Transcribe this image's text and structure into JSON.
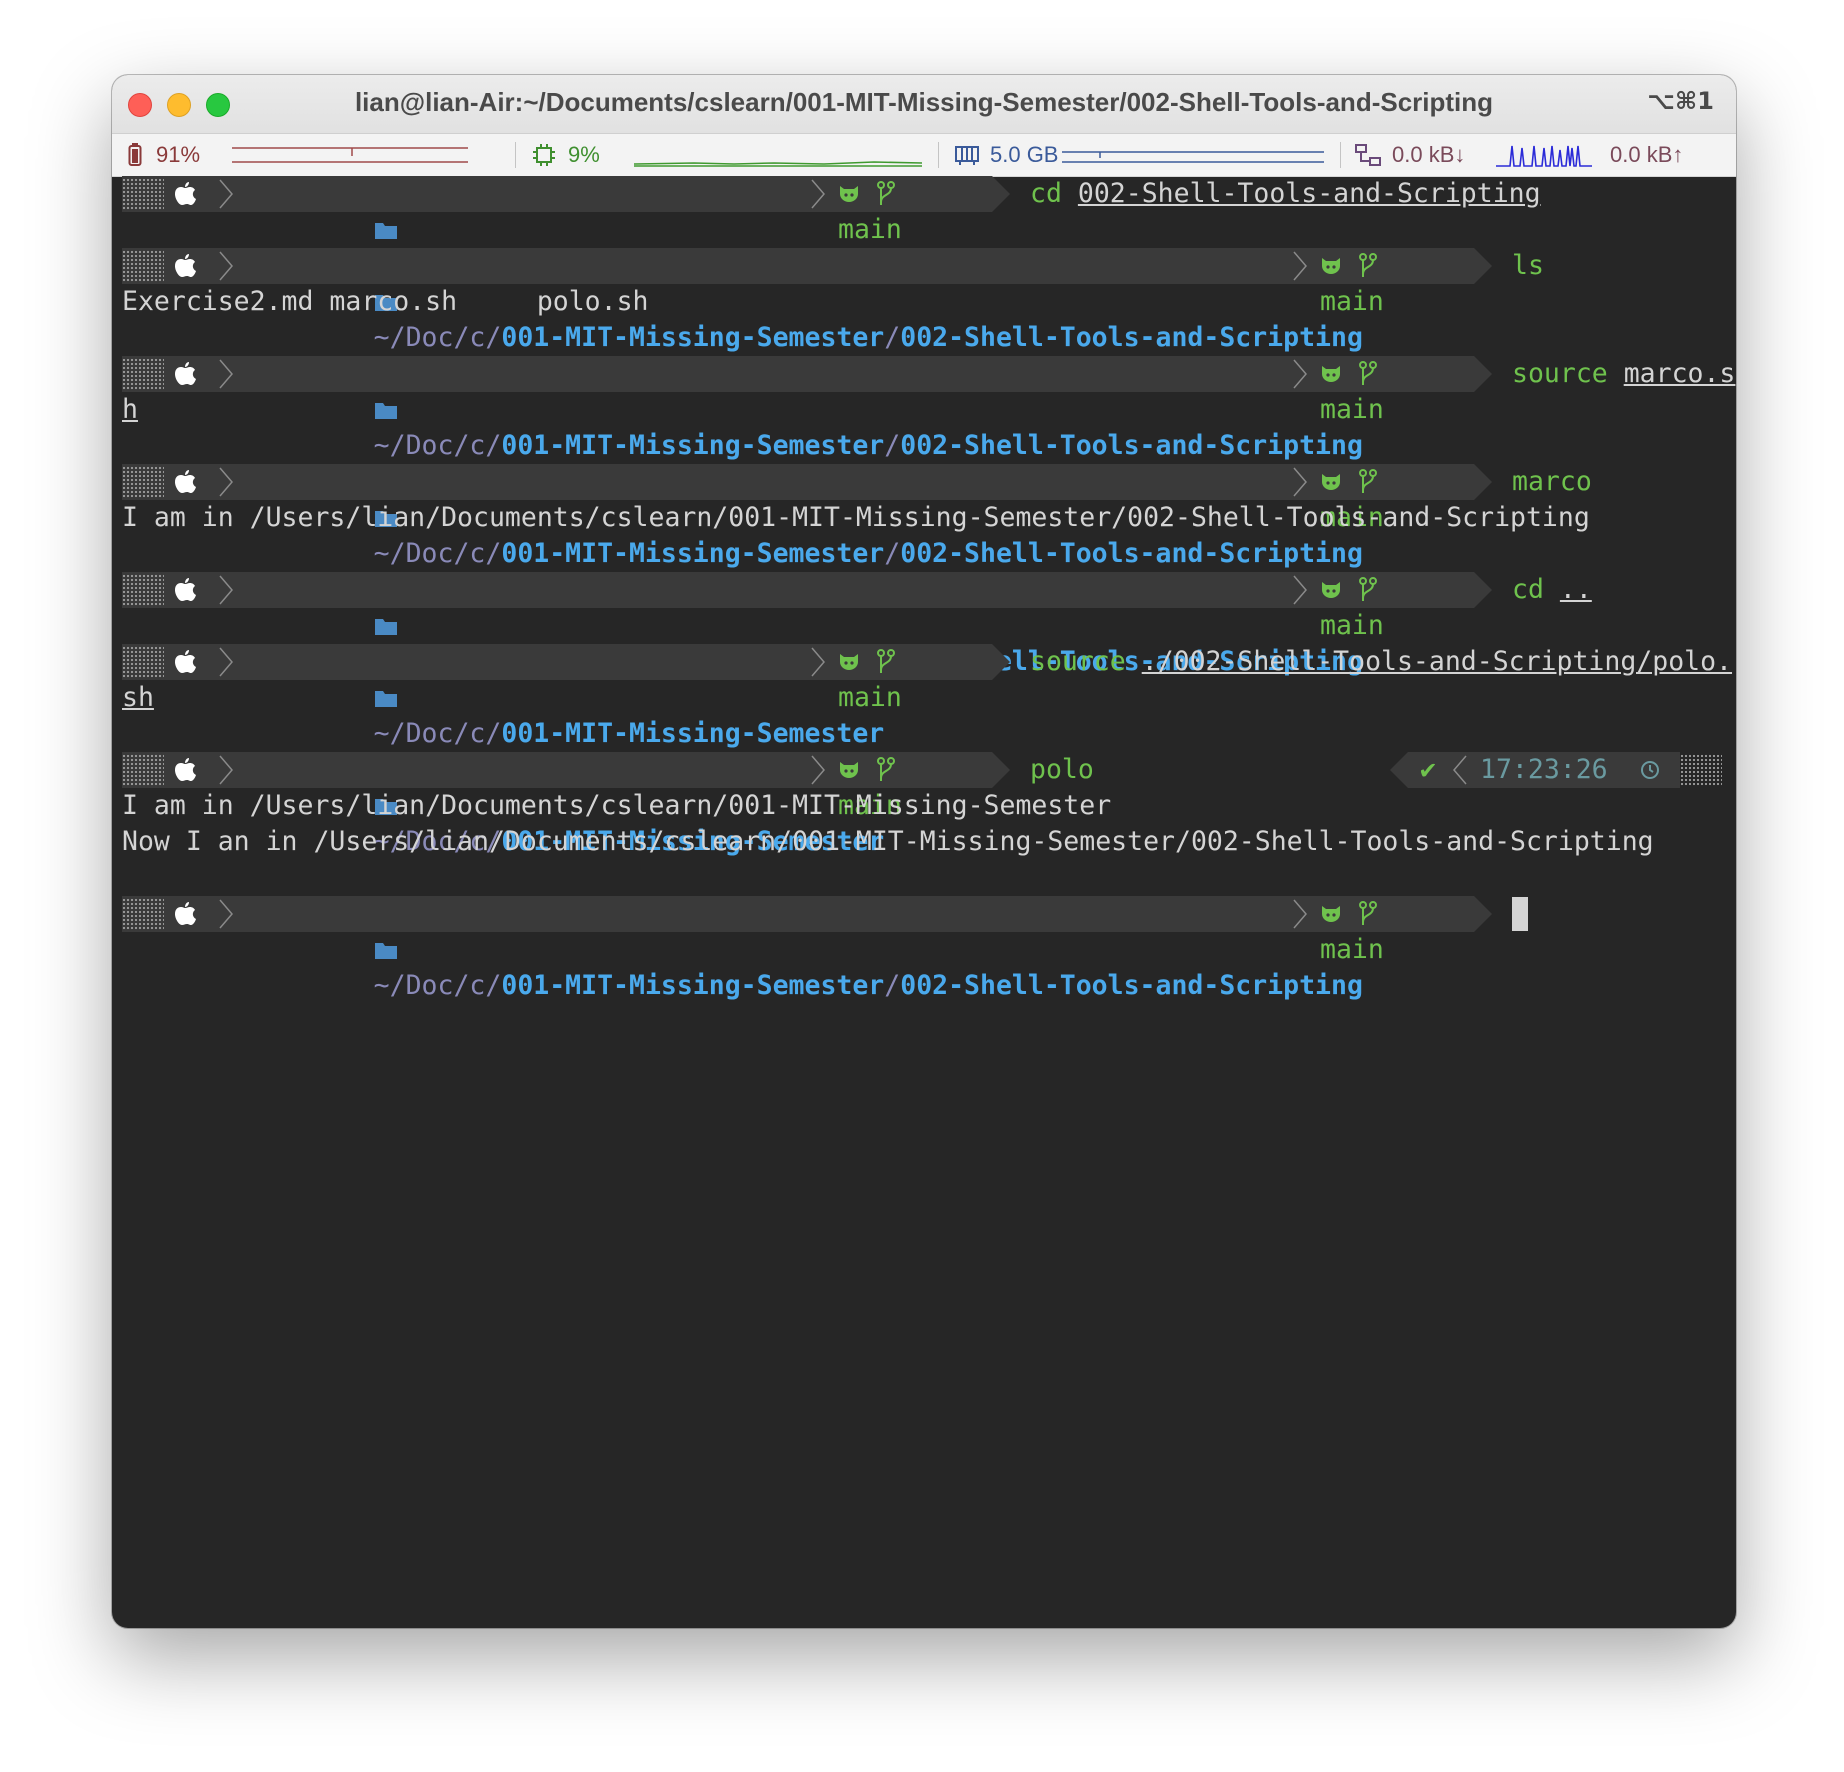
{
  "window": {
    "title": "lian@lian-Air:~/Documents/cslearn/001-MIT-Missing-Semester/002-Shell-Tools-and-Scripting",
    "shortcut": "⌥⌘1"
  },
  "statusbar": {
    "battery": "91%",
    "cpu": "9%",
    "memory": "5.0 GB",
    "net_down": "0.0 kB↓",
    "net_up": "0.0 kB↑"
  },
  "prompt": {
    "dir_home": "~",
    "dir_doc": "Doc",
    "dir_c": "c",
    "dir_parent": "001-MIT-Missing-Semester",
    "dir_child": "002-Shell-Tools-and-Scripting",
    "branch": "main"
  },
  "terminal": {
    "cmd1": "cd",
    "cmd1_arg": "002-Shell-Tools-and-Scripting",
    "cmd2": "ls",
    "ls_output": "Exercise2.md marco.sh     polo.sh",
    "cmd3": "source",
    "cmd3_arg_a": "marco.s",
    "cmd3_arg_b": "h",
    "cmd4": "marco",
    "out4": "I am in /Users/lian/Documents/cslearn/001-MIT-Missing-Semester/002-Shell-Tools-and-Scripting",
    "cmd5": "cd",
    "cmd5_arg": "..",
    "cmd6": "source",
    "cmd6_arg_a": "./002-Shell-Tools-and-Scripting/polo.",
    "cmd6_arg_b": "sh",
    "cmd7": "polo",
    "rprompt_check": "✔",
    "rprompt_time": "17:23:26",
    "out7a": "I am in /Users/lian/Documents/cslearn/001-MIT-Missing-Semester",
    "out7b": "Now I an in /Users/lian/Documents/cslearn/001-MIT-Missing-Semester/002-Shell-Tools-and-Scripting"
  },
  "icons": [
    "apple-icon",
    "folder-icon",
    "github-icon",
    "git-branch-icon",
    "battery-icon",
    "cpu-icon",
    "memory-icon",
    "network-icon",
    "clock-icon"
  ],
  "colors": {
    "terminal_bg": "#262626",
    "segment_bg": "#3a3a3a",
    "path_bold": "#4aa9ec",
    "path_dim": "#8a8ab8",
    "git_green": "#6fc24d",
    "text": "#d4d4d4"
  }
}
